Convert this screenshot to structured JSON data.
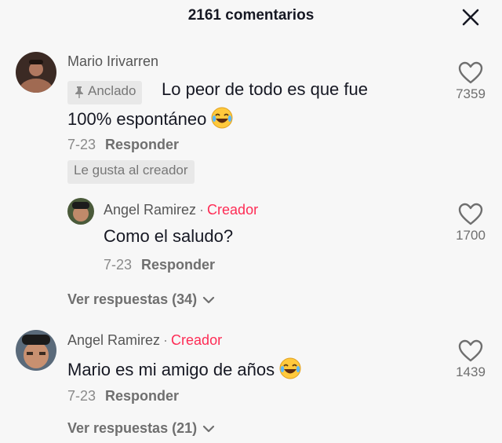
{
  "header": {
    "title": "2161 comentarios"
  },
  "comments": [
    {
      "author": "Mario Irivarren",
      "pinned_label": "Anclado",
      "text_line1": "Lo peor de todo es que fue",
      "text_line2": "100% espontáneo",
      "date": "7-23",
      "reply_label": "Responder",
      "liked_by_creator": "Le gusta al creador",
      "likes": "7359",
      "replies": [
        {
          "author": "Angel Ramirez",
          "creator_badge": "Creador",
          "text": "Como el saludo?",
          "date": "7-23",
          "reply_label": "Responder",
          "likes": "1700"
        }
      ],
      "view_replies": "Ver respuestas (34)"
    },
    {
      "author": "Angel Ramirez",
      "creator_badge": "Creador",
      "text": "Mario es mi amigo de años",
      "date": "7-23",
      "reply_label": "Responder",
      "likes": "1439",
      "view_replies": "Ver respuestas (21)"
    }
  ],
  "colors": {
    "creator": "#fe2c55",
    "text": "#161823",
    "muted": "#8a8a8a"
  }
}
